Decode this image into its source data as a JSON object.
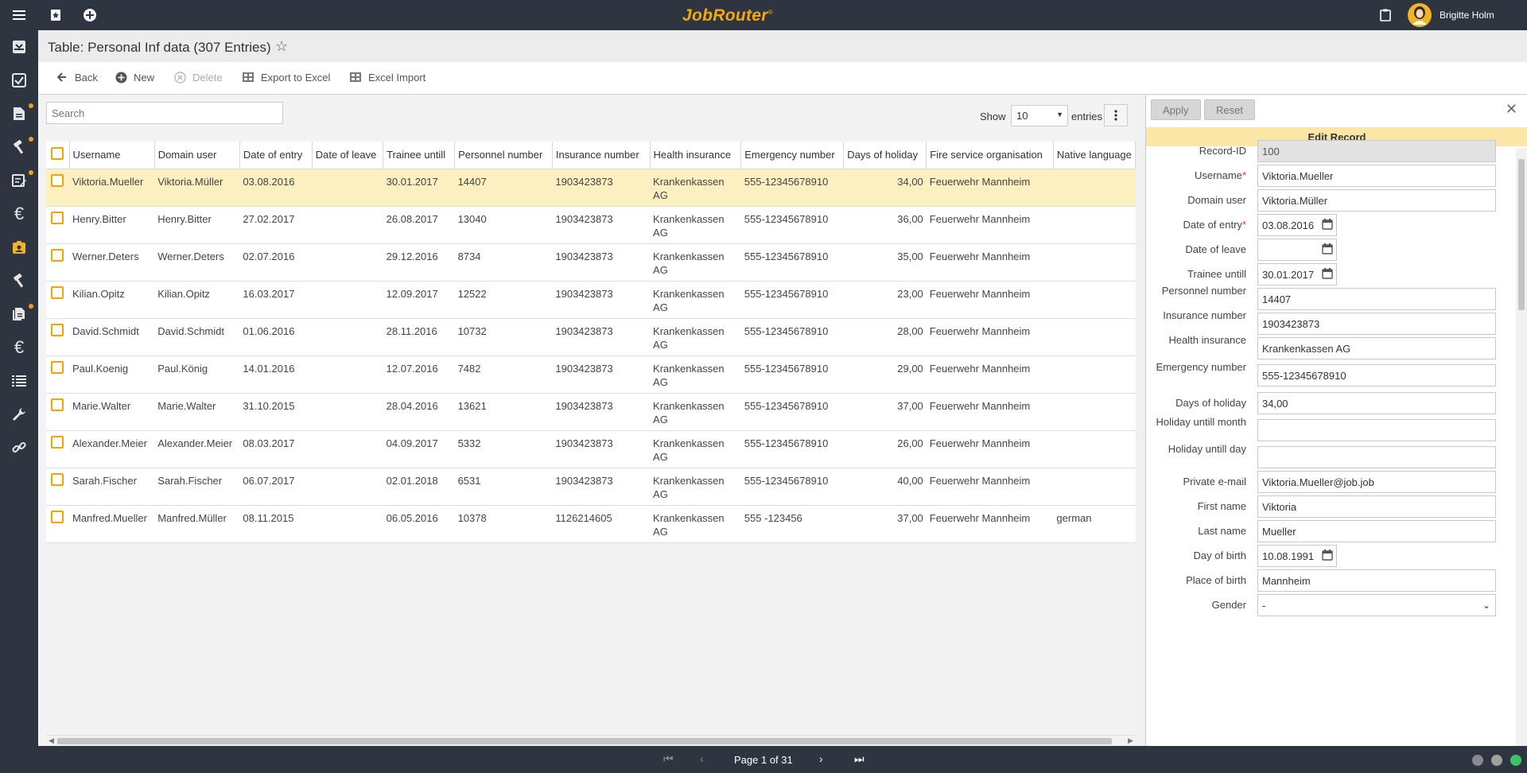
{
  "app": {
    "logo": "JobRouter",
    "logo_mark": "®"
  },
  "user": {
    "name": "Brigitte Holm"
  },
  "page": {
    "title": "Table: Personal Inf data (307 Entries)"
  },
  "toolbar": {
    "back": "Back",
    "new": "New",
    "delete": "Delete",
    "export": "Export to Excel",
    "import": "Excel Import"
  },
  "table_controls": {
    "search_placeholder": "Search",
    "show_label": "Show",
    "show_value": "10",
    "entries_label": "entries"
  },
  "columns": [
    "Username",
    "Domain user",
    "Date of entry",
    "Date of leave",
    "Trainee untill",
    "Personnel number",
    "Insurance number",
    "Health insurance",
    "Emergency number",
    "Days of holiday",
    "Fire service organisation",
    "Native language"
  ],
  "rows": [
    [
      "Viktoria.Mueller",
      "Viktoria.Müller",
      "03.08.2016",
      "",
      "30.01.2017",
      "14407",
      "1903423873",
      "Krankenkassen AG",
      "555-12345678910",
      "34,00",
      "Feuerwehr Mannheim",
      ""
    ],
    [
      "Henry.Bitter",
      "Henry.Bitter",
      "27.02.2017",
      "",
      "26.08.2017",
      "13040",
      "1903423873",
      "Krankenkassen AG",
      "555-12345678910",
      "36,00",
      "Feuerwehr Mannheim",
      ""
    ],
    [
      "Werner.Deters",
      "Werner.Deters",
      "02.07.2016",
      "",
      "29.12.2016",
      "8734",
      "1903423873",
      "Krankenkassen AG",
      "555-12345678910",
      "35,00",
      "Feuerwehr Mannheim",
      ""
    ],
    [
      "Kilian.Opitz",
      "Kilian.Opitz",
      "16.03.2017",
      "",
      "12.09.2017",
      "12522",
      "1903423873",
      "Krankenkassen AG",
      "555-12345678910",
      "23,00",
      "Feuerwehr Mannheim",
      ""
    ],
    [
      "David.Schmidt",
      "David.Schmidt",
      "01.06.2016",
      "",
      "28.11.2016",
      "10732",
      "1903423873",
      "Krankenkassen AG",
      "555-12345678910",
      "28,00",
      "Feuerwehr Mannheim",
      ""
    ],
    [
      "Paul.Koenig",
      "Paul.König",
      "14.01.2016",
      "",
      "12.07.2016",
      "7482",
      "1903423873",
      "Krankenkassen AG",
      "555-12345678910",
      "29,00",
      "Feuerwehr Mannheim",
      ""
    ],
    [
      "Marie.Walter",
      "Marie.Walter",
      "31.10.2015",
      "",
      "28.04.2016",
      "13621",
      "1903423873",
      "Krankenkassen AG",
      "555-12345678910",
      "37,00",
      "Feuerwehr Mannheim",
      ""
    ],
    [
      "Alexander.Meier",
      "Alexander.Meier",
      "08.03.2017",
      "",
      "04.09.2017",
      "5332",
      "1903423873",
      "Krankenkassen AG",
      "555-12345678910",
      "26,00",
      "Feuerwehr Mannheim",
      ""
    ],
    [
      "Sarah.Fischer",
      "Sarah.Fischer",
      "06.07.2017",
      "",
      "02.01.2018",
      "6531",
      "1903423873",
      "Krankenkassen AG",
      "555-12345678910",
      "40,00",
      "Feuerwehr Mannheim",
      ""
    ],
    [
      "Manfred.Mueller",
      "Manfred.Müller",
      "08.11.2015",
      "",
      "06.05.2016",
      "10378",
      "1126214605",
      "Krankenkassen AG",
      "555 -123456",
      "37,00",
      "Feuerwehr Mannheim",
      "german"
    ]
  ],
  "edit_panel": {
    "apply": "Apply",
    "reset": "Reset",
    "title": "Edit Record",
    "fields": [
      {
        "label": "Record-ID",
        "value": "100",
        "readonly": true
      },
      {
        "label": "Username",
        "value": "Viktoria.Mueller",
        "required": true
      },
      {
        "label": "Domain user",
        "value": "Viktoria.Müller"
      },
      {
        "label": "Date of entry",
        "value": "03.08.2016",
        "required": true,
        "type": "date"
      },
      {
        "label": "Date of leave",
        "value": "",
        "type": "date"
      },
      {
        "label": "Trainee untill",
        "value": "30.01.2017",
        "type": "date"
      },
      {
        "label": "Personnel number",
        "value": "14407"
      },
      {
        "label": "Insurance number",
        "value": "1903423873"
      },
      {
        "label": "Health insurance",
        "value": "Krankenkassen AG"
      },
      {
        "label": "Emergency number",
        "value": "555-12345678910"
      },
      {
        "label": "Days of holiday",
        "value": "34,00"
      },
      {
        "label": "Holiday untill month",
        "value": ""
      },
      {
        "label": "Holiday untill day",
        "value": ""
      },
      {
        "label": "Private e-mail",
        "value": "Viktoria.Mueller@job.job"
      },
      {
        "label": "First name",
        "value": "Viktoria"
      },
      {
        "label": "Last name",
        "value": "Mueller"
      },
      {
        "label": "Day of birth",
        "value": "10.08.1991",
        "type": "date"
      },
      {
        "label": "Place of birth",
        "value": "Mannheim"
      },
      {
        "label": "Gender",
        "value": "-",
        "type": "select"
      }
    ]
  },
  "pagination": {
    "page_info": "Page 1 of 31"
  },
  "colors": {
    "accent": "#f2a400",
    "dark": "#2e3440",
    "selected_row": "#fcefc0",
    "panel_header": "#fbe6a8"
  }
}
